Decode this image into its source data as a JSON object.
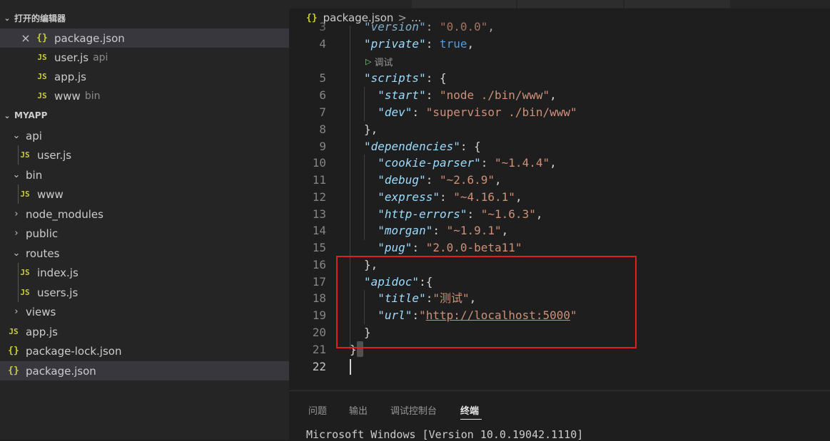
{
  "open_editors": {
    "title": "打开的编辑器",
    "items": [
      {
        "icon": "{}",
        "name": "package.json",
        "desc": "",
        "selected": true,
        "close": "×"
      },
      {
        "icon": "JS",
        "name": "user.js",
        "desc": "api"
      },
      {
        "icon": "JS",
        "name": "app.js",
        "desc": ""
      },
      {
        "icon": "JS",
        "name": "www",
        "desc": "bin"
      }
    ]
  },
  "explorer": {
    "title": "MYAPP",
    "items": [
      {
        "type": "folder",
        "expanded": true,
        "name": "api"
      },
      {
        "type": "js",
        "icon": "JS",
        "name": "user.js"
      },
      {
        "type": "folder",
        "expanded": true,
        "name": "bin"
      },
      {
        "type": "js",
        "icon": "JS",
        "name": "www"
      },
      {
        "type": "folder",
        "expanded": false,
        "name": "node_modules"
      },
      {
        "type": "folder",
        "expanded": false,
        "name": "public"
      },
      {
        "type": "folder",
        "expanded": true,
        "name": "routes"
      },
      {
        "type": "js",
        "icon": "JS",
        "name": "index.js"
      },
      {
        "type": "js",
        "icon": "JS",
        "name": "users.js"
      },
      {
        "type": "folder",
        "expanded": false,
        "name": "views"
      },
      {
        "type": "js",
        "icon": "JS",
        "name": "app.js"
      },
      {
        "type": "json",
        "icon": "{}",
        "name": "package-lock.json"
      },
      {
        "type": "json",
        "icon": "{}",
        "name": "package.json",
        "selected": true
      }
    ]
  },
  "breadcrumb": {
    "icon": "{}",
    "file": "package.json",
    "separator": ">",
    "more": "..."
  },
  "codelens": {
    "label": "调试"
  },
  "code_lines": [
    {
      "n": "3",
      "tokens": [
        [
          "k",
          "\"version\""
        ],
        [
          "p",
          ": "
        ],
        [
          "s",
          "\"0.0.0\""
        ],
        [
          "p",
          ","
        ]
      ]
    },
    {
      "n": "4",
      "tokens": [
        [
          "k",
          "\"private\""
        ],
        [
          "p",
          ": "
        ],
        [
          "b",
          "true"
        ],
        [
          "p",
          ","
        ]
      ]
    },
    {
      "n": "5",
      "tokens": [
        [
          "k",
          "\"scripts\""
        ],
        [
          "p",
          ": {"
        ]
      ]
    },
    {
      "n": "6",
      "tokens": [
        [
          "p",
          "  "
        ],
        [
          "k",
          "\"start\""
        ],
        [
          "p",
          ": "
        ],
        [
          "s",
          "\"node ./bin/www\""
        ],
        [
          "p",
          ","
        ]
      ]
    },
    {
      "n": "7",
      "tokens": [
        [
          "p",
          "  "
        ],
        [
          "k",
          "\"dev\""
        ],
        [
          "p",
          ": "
        ],
        [
          "s",
          "\"supervisor ./bin/www\""
        ]
      ]
    },
    {
      "n": "8",
      "tokens": [
        [
          "p",
          "},"
        ]
      ]
    },
    {
      "n": "9",
      "tokens": [
        [
          "k",
          "\"dependencies\""
        ],
        [
          "p",
          ": {"
        ]
      ]
    },
    {
      "n": "10",
      "tokens": [
        [
          "p",
          "  "
        ],
        [
          "k",
          "\"cookie-parser\""
        ],
        [
          "p",
          ": "
        ],
        [
          "s",
          "\"~1.4.4\""
        ],
        [
          "p",
          ","
        ]
      ]
    },
    {
      "n": "11",
      "tokens": [
        [
          "p",
          "  "
        ],
        [
          "k",
          "\"debug\""
        ],
        [
          "p",
          ": "
        ],
        [
          "s",
          "\"~2.6.9\""
        ],
        [
          "p",
          ","
        ]
      ]
    },
    {
      "n": "12",
      "tokens": [
        [
          "p",
          "  "
        ],
        [
          "k",
          "\"express\""
        ],
        [
          "p",
          ": "
        ],
        [
          "s",
          "\"~4.16.1\""
        ],
        [
          "p",
          ","
        ]
      ]
    },
    {
      "n": "13",
      "tokens": [
        [
          "p",
          "  "
        ],
        [
          "k",
          "\"http-errors\""
        ],
        [
          "p",
          ": "
        ],
        [
          "s",
          "\"~1.6.3\""
        ],
        [
          "p",
          ","
        ]
      ]
    },
    {
      "n": "14",
      "tokens": [
        [
          "p",
          "  "
        ],
        [
          "k",
          "\"morgan\""
        ],
        [
          "p",
          ": "
        ],
        [
          "s",
          "\"~1.9.1\""
        ],
        [
          "p",
          ","
        ]
      ]
    },
    {
      "n": "15",
      "tokens": [
        [
          "p",
          "  "
        ],
        [
          "k",
          "\"pug\""
        ],
        [
          "p",
          ": "
        ],
        [
          "s",
          "\"2.0.0-beta11\""
        ]
      ]
    },
    {
      "n": "16",
      "tokens": [
        [
          "p",
          "},"
        ]
      ]
    },
    {
      "n": "17",
      "tokens": [
        [
          "k",
          "\"apidoc\""
        ],
        [
          "p",
          ":{"
        ]
      ]
    },
    {
      "n": "18",
      "tokens": [
        [
          "p",
          "  "
        ],
        [
          "k",
          "\"title\""
        ],
        [
          "p",
          ":"
        ],
        [
          "s",
          "\"测试\""
        ],
        [
          "p",
          ","
        ]
      ]
    },
    {
      "n": "19",
      "tokens": [
        [
          "p",
          "  "
        ],
        [
          "k",
          "\"url\""
        ],
        [
          "p",
          ":"
        ],
        [
          "s",
          "\""
        ],
        [
          "u",
          "http://localhost:5000"
        ],
        [
          "s",
          "\""
        ]
      ]
    },
    {
      "n": "20",
      "tokens": [
        [
          "p",
          "}"
        ]
      ]
    },
    {
      "n": "21",
      "tokens": [
        [
          "p",
          "}"
        ]
      ],
      "outdent": true
    },
    {
      "n": "22",
      "tokens": [],
      "active": true
    }
  ],
  "panel": {
    "tabs": [
      "问题",
      "输出",
      "调试控制台",
      "终端"
    ],
    "active_tab": "终端",
    "terminal_text": "Microsoft Windows [Version 10.0.19042.1110]"
  },
  "colors": {
    "sidebar_bg": "#252526",
    "editor_bg": "#1e1e1e",
    "key": "#9cdcfe",
    "string": "#ce9178",
    "boolean": "#569cd6",
    "highlight_box": "#e02020",
    "js_icon": "#cbcb41"
  }
}
